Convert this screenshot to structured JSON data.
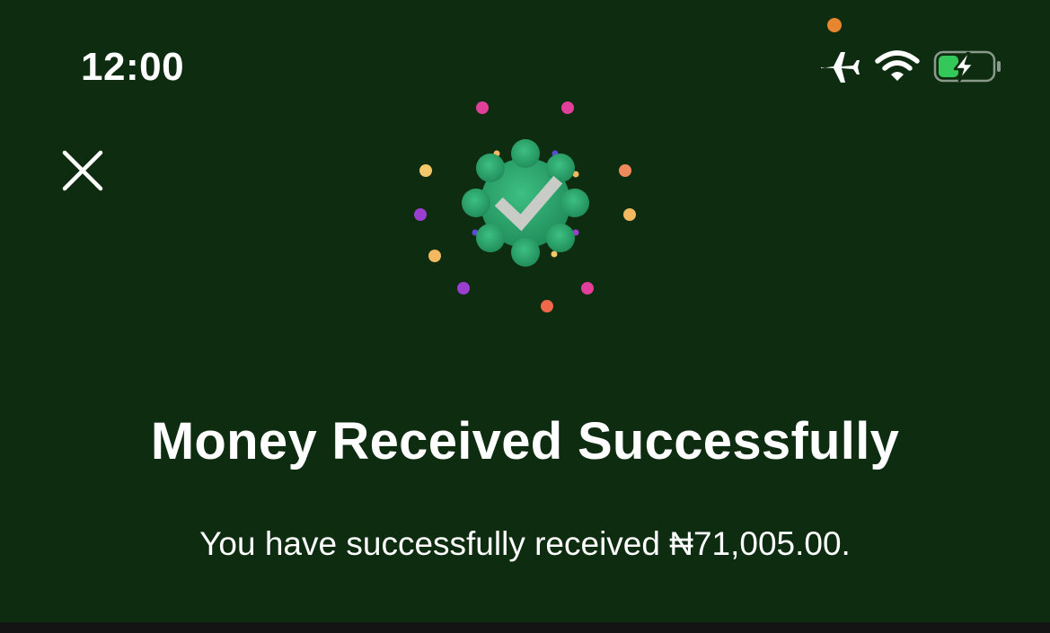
{
  "status_bar": {
    "time": "12:00",
    "icons": [
      "privacy-indicator",
      "airplane-icon",
      "wifi-icon",
      "battery-charging-icon"
    ],
    "privacy_dot_color": "#e8862f",
    "battery_fill_color": "#34c759"
  },
  "header": {
    "close_icon": "close-icon"
  },
  "success": {
    "badge_icon": "check-badge-icon",
    "badge_color": "#2aa66c",
    "confetti_colors": [
      "#e23f9a",
      "#f4b860",
      "#f08a5d",
      "#9b3fd1",
      "#5b4bd6"
    ]
  },
  "message": {
    "title": "Money Received Successfully",
    "body": "You have successfully received ₦71,005.00."
  },
  "colors": {
    "background": "#0d2c10",
    "text": "#ffffff"
  }
}
